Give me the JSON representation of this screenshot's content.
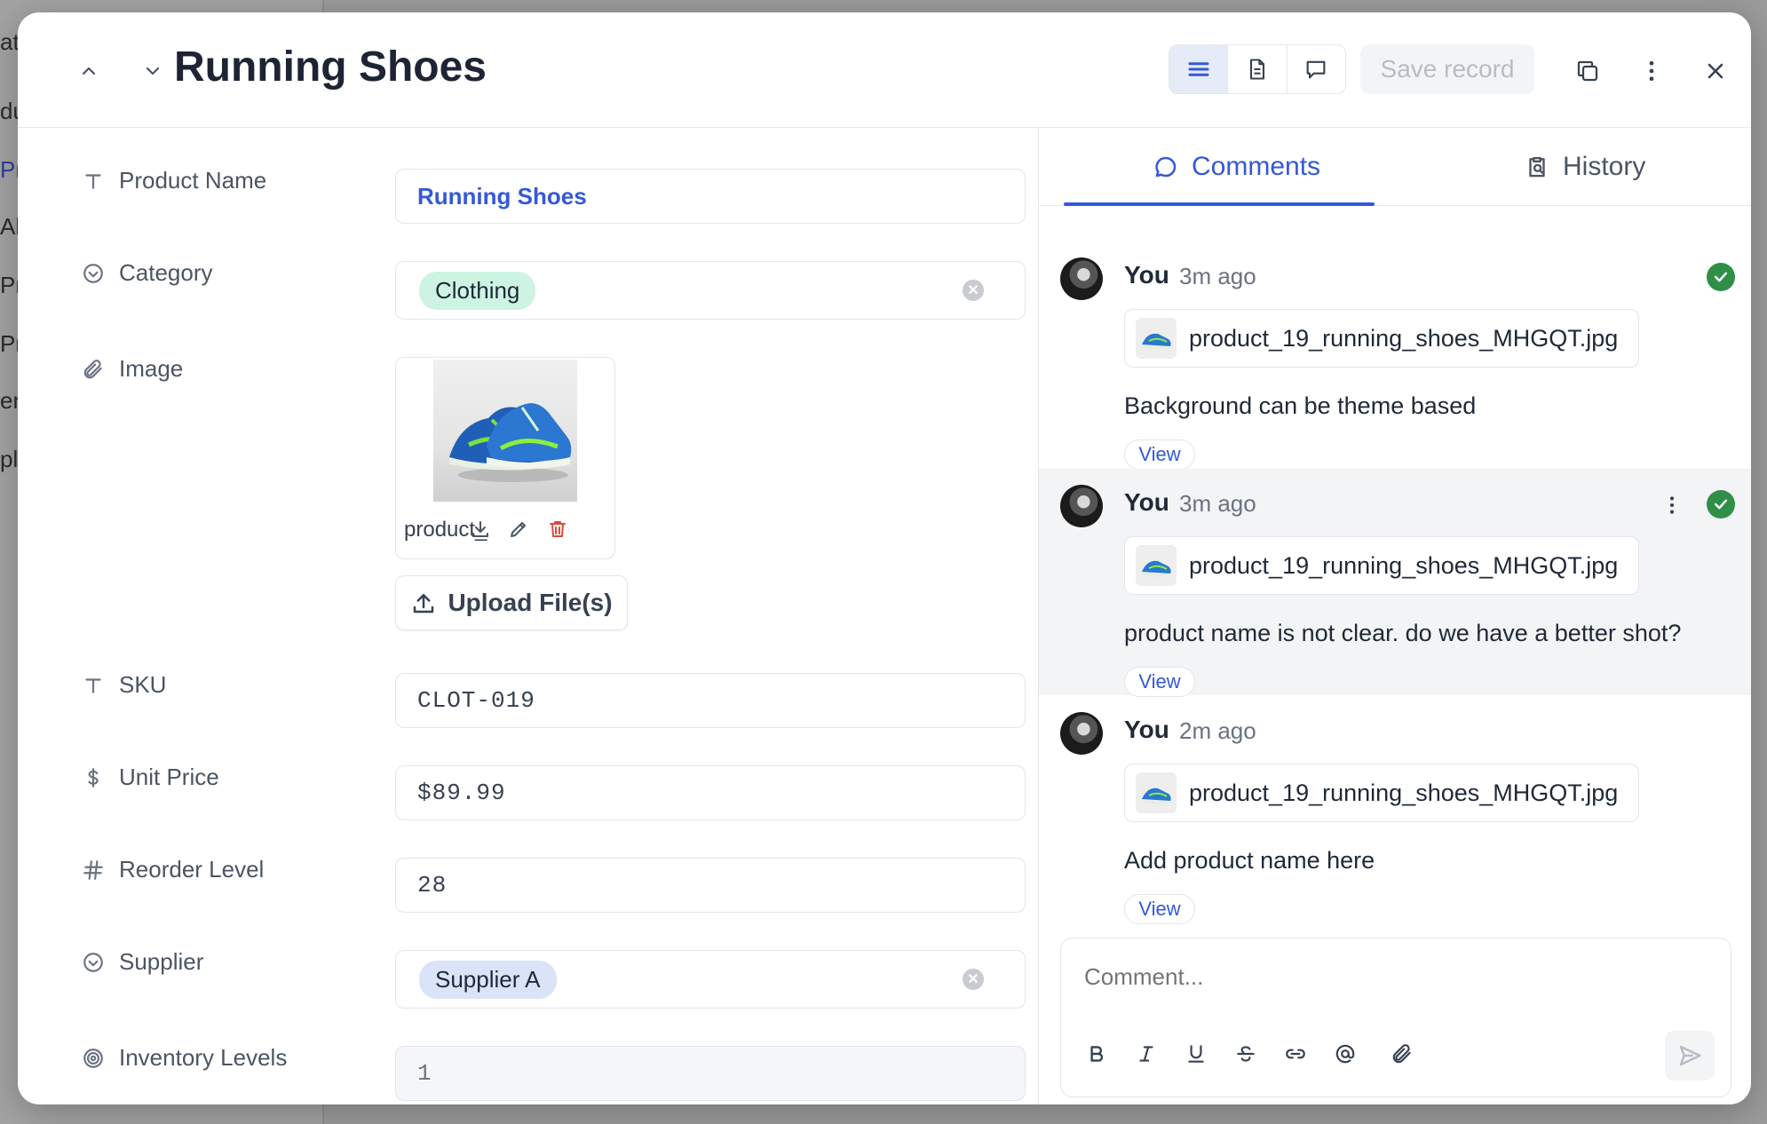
{
  "background_sidebar": [
    "at",
    "du",
    "Pr",
    "Al",
    "Pr",
    "Pr",
    "en",
    "pl"
  ],
  "header": {
    "title": "Running Shoes",
    "save_label": "Save record"
  },
  "fields": {
    "product_name": {
      "label": "Product Name",
      "value": "Running Shoes",
      "icon": "text-type-icon"
    },
    "category": {
      "label": "Category",
      "value": "Clothing",
      "tag_color": "#cdf3e3",
      "icon": "select-circle-icon"
    },
    "image": {
      "label": "Image",
      "filename": "product_",
      "icon": "paperclip-icon"
    },
    "upload_label": "Upload File(s)",
    "sku": {
      "label": "SKU",
      "value": "CLOT-019",
      "icon": "text-type-icon"
    },
    "unit_price": {
      "label": "Unit Price",
      "value": "$89.99",
      "icon": "dollar-icon"
    },
    "reorder_level": {
      "label": "Reorder Level",
      "value": "28",
      "icon": "hash-icon"
    },
    "supplier": {
      "label": "Supplier",
      "value": "Supplier A",
      "tag_color": "#dbe3f8",
      "icon": "select-circle-icon"
    },
    "inventory_levels": {
      "label": "Inventory Levels",
      "value": "1",
      "icon": "rollup-icon"
    }
  },
  "panel": {
    "tabs": [
      {
        "label": "Comments",
        "active": true
      },
      {
        "label": "History",
        "active": false
      }
    ],
    "comments": [
      {
        "author": "You",
        "time": "3m ago",
        "attachment": "product_19_running_shoes_MHGQT.jpg",
        "text": "Background can be theme based",
        "view_label": "View",
        "resolved": true
      },
      {
        "author": "You",
        "time": "3m ago",
        "attachment": "product_19_running_shoes_MHGQT.jpg",
        "text": "product name is not clear. do we have a better shot?",
        "view_label": "View",
        "resolved": true
      },
      {
        "author": "You",
        "time": "2m ago",
        "attachment": "product_19_running_shoes_MHGQT.jpg",
        "text": "Add product name here",
        "view_label": "View",
        "resolved": false
      }
    ],
    "composer_placeholder": "Comment..."
  },
  "colors": {
    "accent": "#3558d8",
    "resolved": "#2f8f46",
    "danger": "#e0483d"
  }
}
